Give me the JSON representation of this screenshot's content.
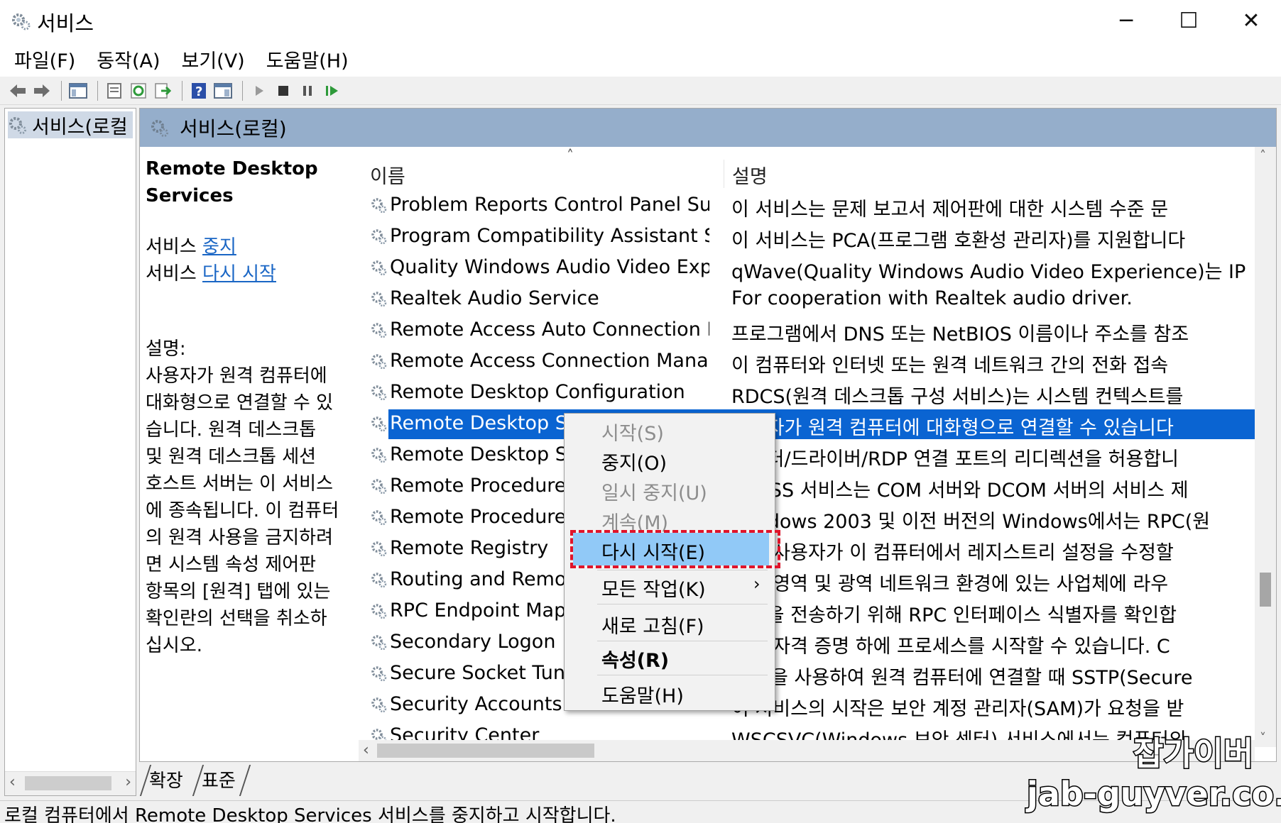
{
  "window": {
    "title": "서비스",
    "min_glyph": "─",
    "max_glyph": "☐",
    "close_glyph": "✕"
  },
  "menu": [
    "파일(F)",
    "동작(A)",
    "보기(V)",
    "도움말(H)"
  ],
  "tree": {
    "root_label": "서비스(로컬"
  },
  "main": {
    "header_title": "서비스(로컬)",
    "detail": {
      "service_name_line1": "Remote Desktop",
      "service_name_line2": "Services",
      "action1_prefix": "서비스",
      "action1_link": "중지",
      "action2_prefix": "서비스",
      "action2_link": "다시 시작",
      "description_label": "설명:",
      "description_lines": [
        "사용자가 원격 컴퓨터에",
        "대화형으로 연결할 수 있",
        "습니다. 원격 데스크톱",
        "및 원격 데스크톱 세션",
        "호스트 서버는 이 서비스",
        "에 종속됩니다. 이 컴퓨터",
        "의 원격 사용을 금지하려",
        "면 시스템 속성 제어판",
        "항목의 [원격] 탭에 있는",
        "확인란의 선택을 취소하",
        "십시오."
      ]
    },
    "columns": {
      "name": "이름",
      "description": "설명",
      "sort_glyph": "˄"
    },
    "rows": [
      {
        "name": "Problem Reports Control Panel Support",
        "desc": "이 서비스는 문제 보고서 제어판에 대한 시스템 수준 문"
      },
      {
        "name": "Program Compatibility Assistant Service",
        "desc": "이 서비스는 PCA(프로그램 호환성 관리자)를 지원합니다"
      },
      {
        "name": "Quality Windows Audio Video Experience",
        "desc": "qWave(Quality Windows Audio Video Experience)는 IP"
      },
      {
        "name": "Realtek Audio Service",
        "desc": "For cooperation with Realtek audio driver."
      },
      {
        "name": "Remote Access Auto Connection Manager",
        "desc": "프로그램에서 DNS 또는 NetBIOS 이름이나 주소를 참조"
      },
      {
        "name": "Remote Access Connection Manager",
        "desc": "이 컴퓨터와 인터넷 또는 원격 네트워크 간의 전화 접속"
      },
      {
        "name": "Remote Desktop Configuration",
        "desc": "RDCS(원격 데스크톱 구성 서비스)는 시스템 컨텍스트를"
      },
      {
        "name": "Remote Desktop Services",
        "desc": "사용자가 원격 컴퓨터에 대화형으로 연결할 수 있습니다"
      },
      {
        "name": "Remote Desktop Se",
        "desc": "프린터/드라이버/RDP 연결 포트의 리디렉션을 허용합니"
      },
      {
        "name": "Remote Procedure",
        "desc": "RPCSS 서비스는 COM 서버와 DCOM 서버의 서비스 제"
      },
      {
        "name": "Remote Procedure",
        "desc": "Windows 2003 및 이전 버전의 Windows에서는 RPC(원"
      },
      {
        "name": "Remote Registry",
        "desc": "원격 사용자가 이 컴퓨터에서 레지스트리 설정을 수정할"
      },
      {
        "name": "Routing and Remot",
        "desc": "로컬 영역 및 광역 네트워크 환경에 있는 사업체에 라우"
      },
      {
        "name": "RPC Endpoint Mapp",
        "desc": "끝점을 전송하기 위해 RPC 인터페이스 식별자를 확인합"
      },
      {
        "name": "Secondary Logon",
        "desc": "대체 자격 증명 하에 프로세스를 시작할 수 있습니다. C"
      },
      {
        "name": "Secure Socket Tunr",
        "desc": "VPN을 사용하여 원격 컴퓨터에 연결할 때 SSTP(Secure"
      },
      {
        "name": "Security Accounts M",
        "desc": "이 서비스의 시작은 보안 계정 관리자(SAM)가 요청을 받"
      },
      {
        "name": "Security Center",
        "desc": "WSCSVC(Windows 보안 센터) 서비스에서는 컴퓨터의"
      }
    ]
  },
  "context_menu": {
    "start": "시작(S)",
    "stop": "중지(O)",
    "pause": "일시 중지(U)",
    "resume": "계속(M)",
    "restart": "다시 시작(E)",
    "all_tasks": "모든 작업(K)",
    "all_tasks_arrow": "›",
    "refresh": "새로 고침(F)",
    "properties": "속성(R)",
    "help": "도움말(H)"
  },
  "tabs": {
    "extended": "확장",
    "standard": "표준"
  },
  "statusbar": "로컬 컴퓨터에서 Remote Desktop Services 서비스를 중지하고 시작합니다.",
  "watermark": {
    "line1": "잡가이버",
    "line2": "jab-guyver.co.kr"
  },
  "colors": {
    "header_bg": "#95aecb",
    "selection": "#0a64d2",
    "menu_highlight": "#91c9f7",
    "highlight_frame": "#e0142a",
    "link": "#1a66c5"
  }
}
